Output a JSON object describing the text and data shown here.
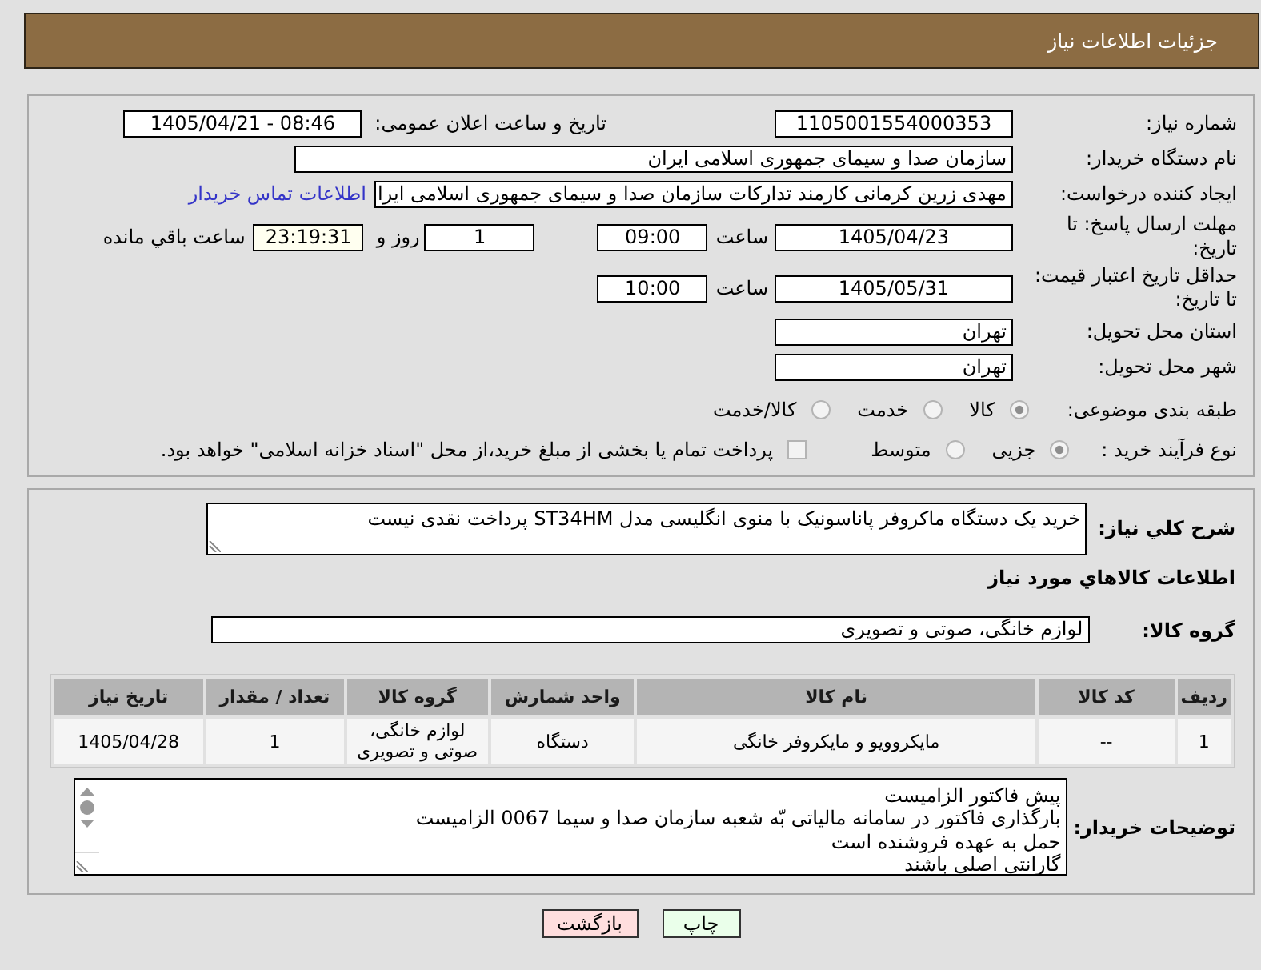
{
  "header": {
    "title": "جزئیات اطلاعات نیاز"
  },
  "details": {
    "need_number": {
      "label": "شماره نیاز:",
      "value": "1105001554000353"
    },
    "announcement": {
      "label": "تاریخ و ساعت اعلان عمومی:",
      "value": "1405/04/21 - 08:46"
    },
    "buyer": {
      "label": "نام دستگاه خریدار:",
      "value": "سازمان صدا و سیمای جمهوری اسلامی ایران"
    },
    "requester": {
      "label": "ایجاد کننده درخواست:",
      "value": "مهدی زرین کرمانی کارمند تدارکات سازمان صدا و سیمای جمهوری اسلامی ایرا",
      "contact_link": "اطلاعات تماس خریدار"
    },
    "reply_deadline": {
      "label": "مهلت ارسال پاسخ: تا تاریخ:",
      "date": "1405/04/23",
      "time_label": "ساعت",
      "time": "09:00",
      "days": "1",
      "days_label": "روز و",
      "remaining": "23:19:31",
      "remaining_label": "ساعت باقي مانده"
    },
    "price_validity": {
      "label": "حداقل تاریخ اعتبار قیمت: تا تاریخ:",
      "date": "1405/05/31",
      "time_label": "ساعت",
      "time": "10:00"
    },
    "province": {
      "label": "استان محل تحویل:",
      "value": "تهران"
    },
    "city": {
      "label": "شهر محل تحویل:",
      "value": "تهران"
    },
    "category": {
      "label": "طبقه بندی موضوعی:",
      "options": [
        {
          "label": "کالا",
          "selected": true
        },
        {
          "label": "خدمت",
          "selected": false
        },
        {
          "label": "کالا/خدمت",
          "selected": false
        }
      ]
    },
    "purchase_type": {
      "label": "نوع فرآیند خرید :",
      "options": [
        {
          "label": "جزیی",
          "selected": true
        },
        {
          "label": "متوسط",
          "selected": false
        }
      ],
      "treasury_payment": {
        "label": "پرداخت تمام یا بخشی از مبلغ خرید،از محل \"اسناد خزانه اسلامی\" خواهد بود.",
        "checked": false
      }
    }
  },
  "needs": {
    "summary": {
      "label": "شرح کلي نیاز:",
      "value": "خرید یک دستگاه ماکروفر پاناسونیک با منوی انگلیسی مدل ST34HM پرداخت نقدی نیست"
    },
    "goods_heading": "اطلاعات کالاهاي مورد نیاز",
    "goods_group": {
      "label": "گروه کالا:",
      "value": "لوازم خانگی، صوتی و تصویری"
    },
    "table": {
      "columns": [
        "ردیف",
        "کد کالا",
        "نام کالا",
        "واحد شمارش",
        "گروه کالا",
        "تعداد / مقدار",
        "تاریخ نیاز"
      ],
      "rows": [
        [
          "1",
          "--",
          "مایکروویو و مایکروفر خانگی",
          "دستگاه",
          "لوازم خانگی، صوتی و تصویری",
          "1",
          "1405/04/28"
        ]
      ]
    },
    "buyer_notes": {
      "label": "توضیحات خریدار:",
      "lines": [
        "پیش فاکتور الزامیست",
        "بارگذاری فاکتور در سامانه مالیاتی بّه شعبه سازمان صدا و سیما 0067 الزامیست",
        "حمل به عهده فروشنده است",
        "گارانتی اصلی باشند"
      ]
    }
  },
  "buttons": [
    {
      "label": "چاپ",
      "kind": "print"
    },
    {
      "label": "بازگشت",
      "kind": "back"
    }
  ]
}
